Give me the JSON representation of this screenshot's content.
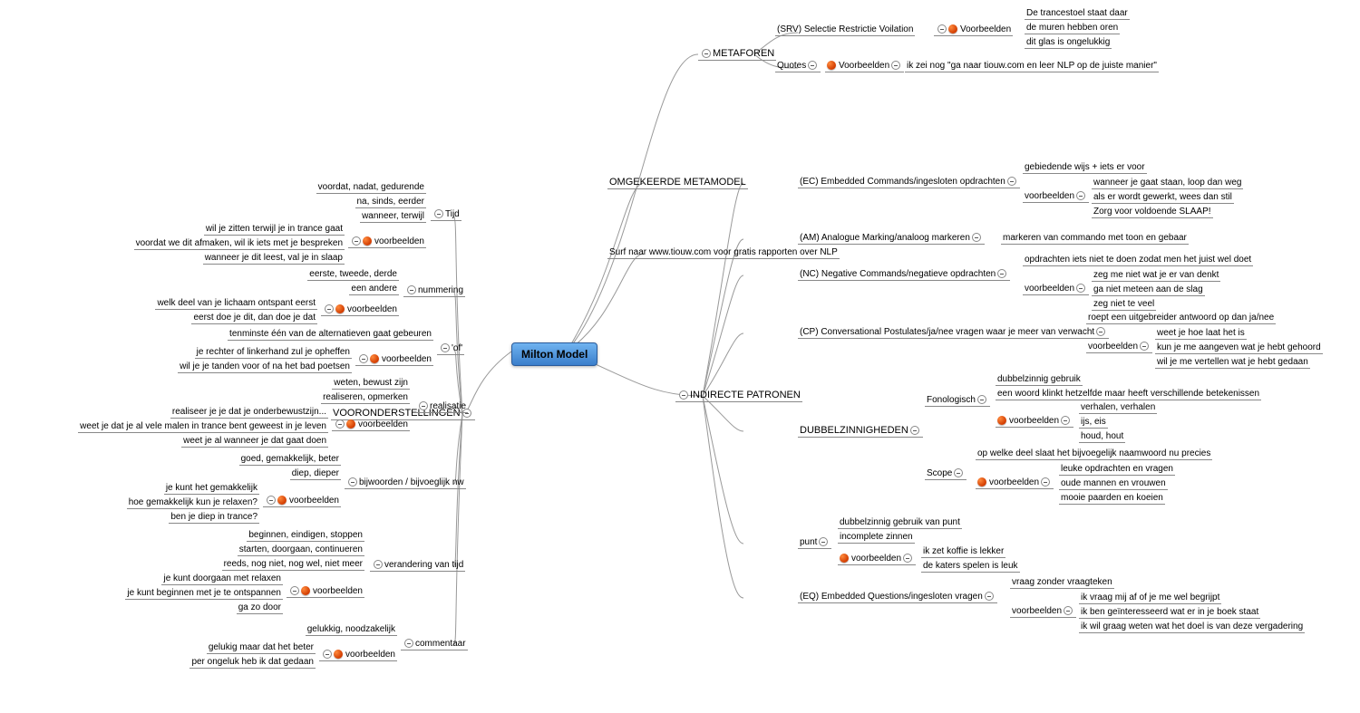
{
  "center": "Milton Model",
  "right_branches": {
    "metaforen": {
      "title": "METAFOREN",
      "children": [
        {
          "label": "(SRV) Selectie Restrictie Voilation",
          "vb_label": "Voorbeelden",
          "examples": [
            "De trancestoel staat daar",
            "de muren hebben oren",
            "dit glas is ongelukkig"
          ]
        },
        {
          "label": "Quotes",
          "vb_label": "Voorbeelden",
          "examples": [
            "ik zei nog \"ga naar tiouw.com en leer NLP op de juiste manier\""
          ]
        }
      ]
    },
    "omgekeerde": {
      "title": "OMGEKEERDE METAMODEL"
    },
    "surf": {
      "title": "Surf naar www.tiouw.com voor gratis rapporten over NLP"
    },
    "indirecte": {
      "title": "INDIRECTE PATRONEN",
      "ec": {
        "label": "(EC) Embedded Commands/ingesloten opdrachten",
        "sub": [
          "gebiedende wijs + iets er voor"
        ],
        "vb_label": "voorbeelden",
        "examples": [
          "wanneer je gaat staan, loop dan weg",
          "als er wordt gewerkt, wees dan stil",
          "Zorg voor voldoende SLAAP!"
        ]
      },
      "am": {
        "label": "(AM) Analogue Marking/analoog markeren",
        "sub": [
          "markeren van commando met toon en gebaar"
        ]
      },
      "nc": {
        "label": "(NC) Negative Commands/negatieve opdrachten",
        "sub": [
          "opdrachten iets niet te doen zodat men het juist wel doet"
        ],
        "vb_label": "voorbeelden",
        "examples": [
          "zeg me niet wat je er van denkt",
          "ga niet meteen aan de slag",
          "zeg niet te veel"
        ]
      },
      "cp": {
        "label": "(CP) Conversational Postulates/ja/nee vragen waar je meer van verwacht",
        "sub": [
          "roept een uitgebreider antwoord op dan ja/nee"
        ],
        "vb_label": "voorbeelden",
        "examples": [
          "weet je hoe laat het is",
          "kun je me aangeven wat je hebt gehoord",
          "wil je me vertellen wat je hebt gedaan"
        ]
      },
      "dubbel": {
        "title": "DUBBELZINNIGHEDEN",
        "fono": {
          "label": "Fonologisch",
          "sub": [
            "dubbelzinnig gebruik",
            "een woord klinkt hetzelfde maar heeft verschillende betekenissen"
          ],
          "vb_label": "voorbeelden",
          "examples": [
            "verhalen, verhalen",
            "ijs, eis",
            "houd, hout"
          ]
        },
        "scope": {
          "label": "Scope",
          "sub": [
            "op welke deel slaat het bijvoegelijk naamwoord nu precies"
          ],
          "vb_label": "voorbeelden",
          "examples": [
            "leuke opdrachten en vragen",
            "oude mannen en vrouwen",
            "mooie paarden en koeien"
          ]
        }
      },
      "punt": {
        "label": "punt",
        "sub": [
          "dubbelzinnig gebruik van punt",
          "incomplete zinnen"
        ],
        "vb_label": "voorbeelden",
        "examples": [
          "ik zet koffie is lekker",
          "de katers spelen is leuk"
        ]
      },
      "eq": {
        "label": "(EQ) Embedded Questions/ingesloten vragen",
        "sub": [
          "vraag zonder vraagteken"
        ],
        "vb_label": "voorbeelden",
        "examples": [
          "ik vraag mij af of je me wel begrijpt",
          "ik ben geïnteresseerd wat er in je boek staat",
          "ik wil graag weten wat het doel is van deze vergadering"
        ]
      }
    }
  },
  "left_branches": {
    "vooronder": {
      "title": "VOORONDERSTELLINGEN",
      "tijd": {
        "label": "Tijd",
        "sub": [
          "voordat, nadat, gedurende",
          "na, sinds, eerder",
          "wanneer, terwijl"
        ],
        "vb_label": "voorbeelden",
        "examples": [
          "wil je zitten terwijl je in trance gaat",
          "voordat we dit afmaken, wil ik iets met je bespreken",
          "wanneer je dit leest, val je in slaap"
        ]
      },
      "nummer": {
        "label": "nummering",
        "sub": [
          "eerste, tweede, derde",
          "een andere"
        ],
        "vb_label": "voorbeelden",
        "examples": [
          "welk deel van je lichaam ontspant eerst",
          "eerst doe je dit, dan doe je dat"
        ]
      },
      "of": {
        "label": "'of'",
        "sub": [
          "tenminste één van de alternatieven gaat gebeuren"
        ],
        "vb_label": "voorbeelden",
        "examples": [
          "je rechter of linkerhand zul je opheffen",
          "wil je je tanden voor of na het bad poetsen"
        ]
      },
      "realisatie": {
        "label": "realisatie",
        "sub": [
          "weten, bewust zijn",
          "realiseren, opmerken"
        ],
        "vb_label": "voorbeelden",
        "examples": [
          "realiseer je je dat je onderbewustzijn...",
          "weet je dat je al vele malen in trance bent geweest in je leven",
          "weet je al wanneer je dat gaat doen"
        ]
      },
      "bijw": {
        "label": "bijwoorden / bijvoeglijk nw",
        "sub": [
          "goed, gemakkelijk, beter",
          "diep, dieper"
        ],
        "vb_label": "voorbeelden",
        "examples": [
          "je kunt het gemakkelijk",
          "hoe gemakkelijk kun je relaxen?",
          "ben je diep in trance?"
        ]
      },
      "verandering": {
        "label": "verandering van tijd",
        "sub": [
          "beginnen, eindigen, stoppen",
          "starten, doorgaan, continueren",
          "reeds, nog niet, nog wel, niet meer"
        ],
        "vb_label": "voorbeelden",
        "examples": [
          "je kunt doorgaan met relaxen",
          "je kunt beginnen met je te ontspannen",
          "ga zo door"
        ]
      },
      "commentaar": {
        "label": "commentaar",
        "sub": [
          "gelukkig, noodzakelijk"
        ],
        "vb_label": "voorbeelden",
        "examples": [
          "gelukig maar dat het beter",
          "per ongeluk heb ik dat gedaan"
        ]
      }
    }
  }
}
